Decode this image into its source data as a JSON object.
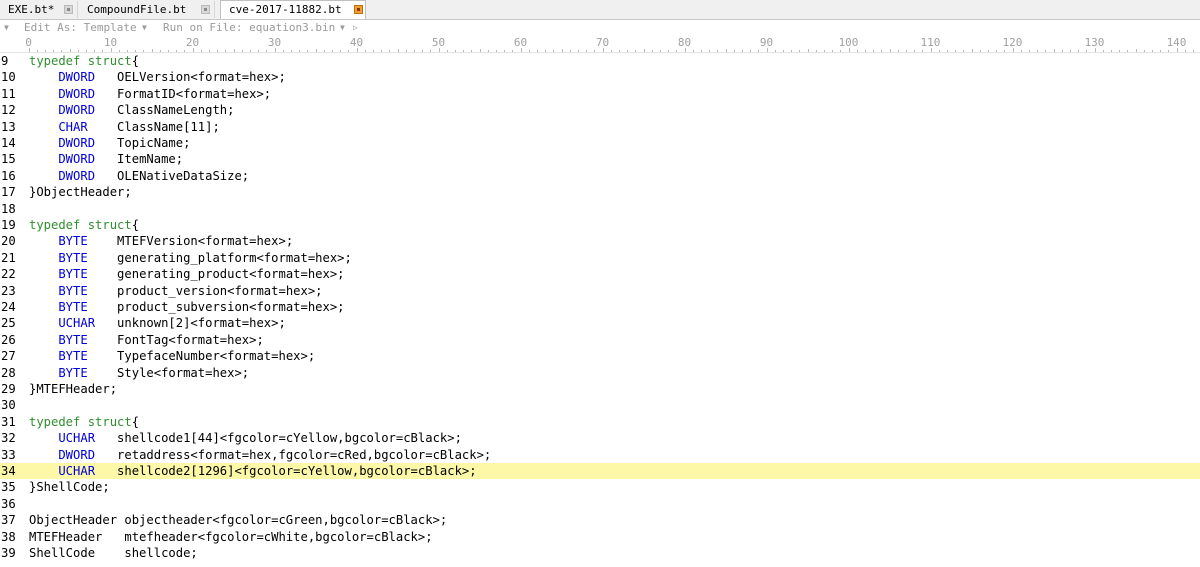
{
  "tabs": [
    {
      "label": "EXE.bt*",
      "active": false
    },
    {
      "label": "CompoundFile.bt",
      "active": false
    },
    {
      "label": "cve-2017-11882.bt",
      "active": true
    }
  ],
  "toolbar": {
    "edit_as": "Edit As: Template",
    "run_on": "Run on File: equation3.bin"
  },
  "ruler": {
    "labels": [
      "0",
      "10",
      "20",
      "30",
      "40",
      "50",
      "60",
      "70",
      "80",
      "90",
      "100",
      "110",
      "120",
      "130",
      "140"
    ]
  },
  "colors": {
    "keyword": "#2f8f2f",
    "type": "#0000d8",
    "highlight": "#fcf8a8",
    "active_tab_close": "#f0a030"
  },
  "editor": {
    "highlighted_line": "34",
    "lines": [
      {
        "n": "9",
        "kw": "typedef struct",
        "ty": "",
        "text": "{"
      },
      {
        "n": "10",
        "kw": "",
        "ty": "    DWORD",
        "text": "   OELVersion<format=hex>;"
      },
      {
        "n": "11",
        "kw": "",
        "ty": "    DWORD",
        "text": "   FormatID<format=hex>;"
      },
      {
        "n": "12",
        "kw": "",
        "ty": "    DWORD",
        "text": "   ClassNameLength;"
      },
      {
        "n": "13",
        "kw": "",
        "ty": "    CHAR",
        "text": "    ClassName[11];"
      },
      {
        "n": "14",
        "kw": "",
        "ty": "    DWORD",
        "text": "   TopicName;"
      },
      {
        "n": "15",
        "kw": "",
        "ty": "    DWORD",
        "text": "   ItemName;"
      },
      {
        "n": "16",
        "kw": "",
        "ty": "    DWORD",
        "text": "   OLENativeDataSize;"
      },
      {
        "n": "17",
        "kw": "",
        "ty": "",
        "text": "}ObjectHeader;"
      },
      {
        "n": "18",
        "kw": "",
        "ty": "",
        "text": ""
      },
      {
        "n": "19",
        "kw": "typedef struct",
        "ty": "",
        "text": "{"
      },
      {
        "n": "20",
        "kw": "",
        "ty": "    BYTE",
        "text": "    MTEFVersion<format=hex>;"
      },
      {
        "n": "21",
        "kw": "",
        "ty": "    BYTE",
        "text": "    generating_platform<format=hex>;"
      },
      {
        "n": "22",
        "kw": "",
        "ty": "    BYTE",
        "text": "    generating_product<format=hex>;"
      },
      {
        "n": "23",
        "kw": "",
        "ty": "    BYTE",
        "text": "    product_version<format=hex>;"
      },
      {
        "n": "24",
        "kw": "",
        "ty": "    BYTE",
        "text": "    product_subversion<format=hex>;"
      },
      {
        "n": "25",
        "kw": "",
        "ty": "    UCHAR",
        "text": "   unknown[2]<format=hex>;"
      },
      {
        "n": "26",
        "kw": "",
        "ty": "    BYTE",
        "text": "    FontTag<format=hex>;"
      },
      {
        "n": "27",
        "kw": "",
        "ty": "    BYTE",
        "text": "    TypefaceNumber<format=hex>;"
      },
      {
        "n": "28",
        "kw": "",
        "ty": "    BYTE",
        "text": "    Style<format=hex>;"
      },
      {
        "n": "29",
        "kw": "",
        "ty": "",
        "text": "}MTEFHeader;"
      },
      {
        "n": "30",
        "kw": "",
        "ty": "",
        "text": ""
      },
      {
        "n": "31",
        "kw": "typedef struct",
        "ty": "",
        "text": "{"
      },
      {
        "n": "32",
        "kw": "",
        "ty": "    UCHAR",
        "text": "   shellcode1[44]<fgcolor=cYellow,bgcolor=cBlack>;"
      },
      {
        "n": "33",
        "kw": "",
        "ty": "    DWORD",
        "text": "   retaddress<format=hex,fgcolor=cRed,bgcolor=cBlack>;"
      },
      {
        "n": "34",
        "kw": "",
        "ty": "    UCHAR",
        "text": "   shellcode2[1296]<fgcolor=cYellow,bgcolor=cBlack>;"
      },
      {
        "n": "35",
        "kw": "",
        "ty": "",
        "text": "}ShellCode;"
      },
      {
        "n": "36",
        "kw": "",
        "ty": "",
        "text": ""
      },
      {
        "n": "37",
        "kw": "",
        "ty": "",
        "text": "ObjectHeader objectheader<fgcolor=cGreen,bgcolor=cBlack>;"
      },
      {
        "n": "38",
        "kw": "",
        "ty": "",
        "text": "MTEFHeader   mtefheader<fgcolor=cWhite,bgcolor=cBlack>;"
      },
      {
        "n": "39",
        "kw": "",
        "ty": "",
        "text": "ShellCode    shellcode;"
      }
    ]
  }
}
